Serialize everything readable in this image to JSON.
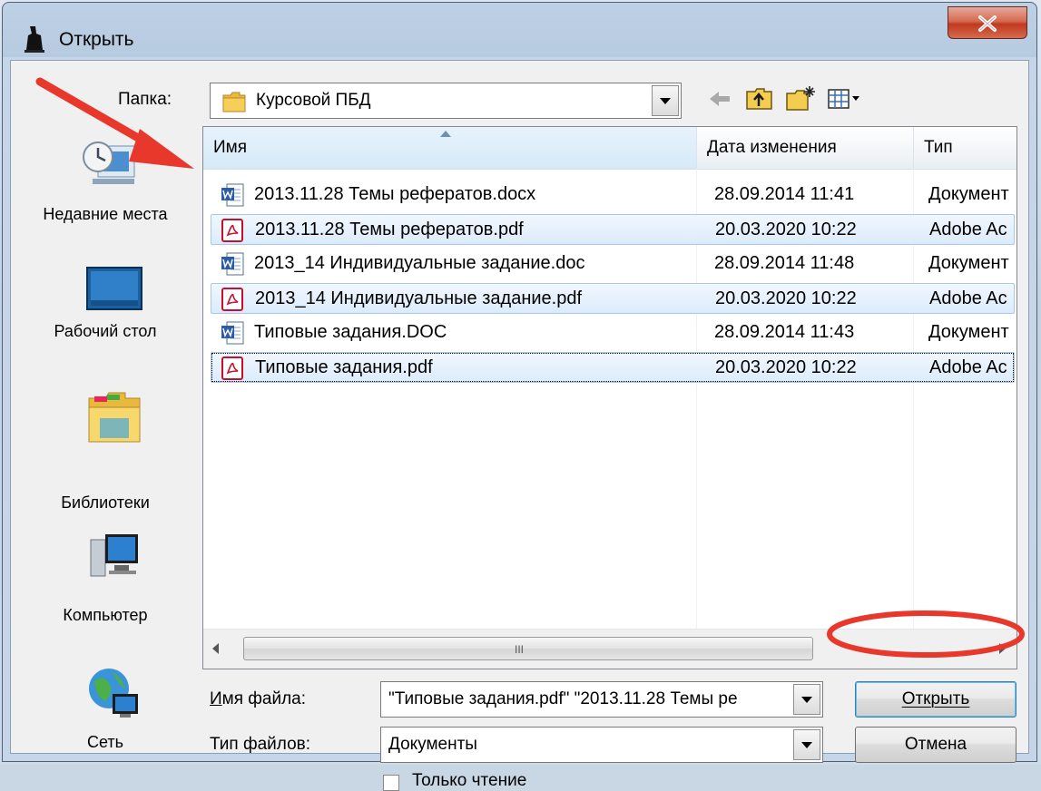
{
  "window": {
    "title": "Открыть",
    "close_label": "×"
  },
  "toolbar": {
    "folder_label": "Папка:",
    "folder_value": "Курсовой ПБД",
    "back_icon": "back-arrow-icon",
    "up_icon": "folder-up-icon",
    "new_folder_icon": "new-folder-icon",
    "views_icon": "views-menu-icon"
  },
  "places": [
    {
      "label": "Недавние места",
      "icon": "recent-places-icon"
    },
    {
      "label": "Рабочий стол",
      "icon": "desktop-icon"
    },
    {
      "label": "Библиотеки",
      "icon": "libraries-icon"
    },
    {
      "label": "Компьютер",
      "icon": "computer-icon"
    },
    {
      "label": "Сеть",
      "icon": "network-icon"
    }
  ],
  "filelist": {
    "columns": [
      "Имя",
      "Дата изменения",
      "Тип"
    ],
    "rows": [
      {
        "name": "2013.11.28 Темы рефератов.docx",
        "date": "28.09.2014 11:41",
        "type": "Документ",
        "icon": "word-document-icon",
        "selected": false
      },
      {
        "name": "2013.11.28 Темы рефератов.pdf",
        "date": "20.03.2020 10:22",
        "type": "Adobe Ac",
        "icon": "pdf-document-icon",
        "selected": true
      },
      {
        "name": "2013_14 Индивидуальные задание.doc",
        "date": "28.09.2014 11:48",
        "type": "Документ",
        "icon": "word-document-icon",
        "selected": false
      },
      {
        "name": "2013_14 Индивидуальные задание.pdf",
        "date": "20.03.2020 10:22",
        "type": "Adobe Ac",
        "icon": "pdf-document-icon",
        "selected": true
      },
      {
        "name": "Типовые задания.DOC",
        "date": "28.09.2014 11:43",
        "type": "Документ",
        "icon": "word-document-icon",
        "selected": false
      },
      {
        "name": "Типовые задания.pdf",
        "date": "20.03.2020 10:22",
        "type": "Adobe Ac",
        "icon": "pdf-document-icon",
        "selected": true
      }
    ],
    "scroll_grip": "III"
  },
  "form": {
    "filename_label": "Имя файла:",
    "filename_value": "\"Типовые задания.pdf\" \"2013.11.28 Темы ре",
    "filetype_label": "Тип файлов:",
    "filetype_value": "Документы",
    "readonly_label": "Только чтение",
    "open_button": "Открыть",
    "cancel_button": "Отмена"
  },
  "colors": {
    "annotation_red": "#e8382c",
    "selection_border": "#a5c8eb"
  }
}
